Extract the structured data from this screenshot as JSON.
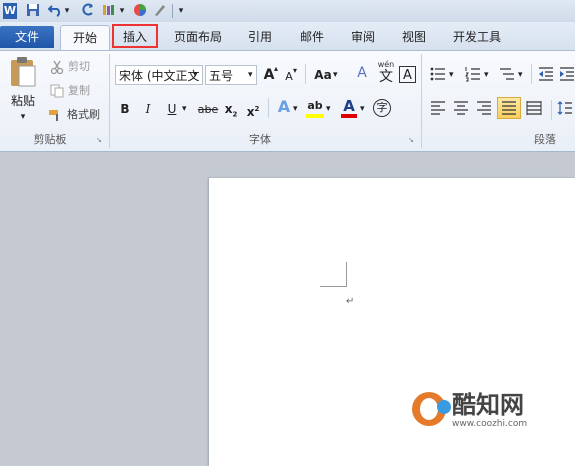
{
  "qat": {
    "word_icon": "W",
    "dropdown_arrow": "▾"
  },
  "tabs": {
    "file": "文件",
    "home": "开始",
    "insert": "插入",
    "page_layout": "页面布局",
    "references": "引用",
    "mailings": "邮件",
    "review": "审阅",
    "view": "视图",
    "developer": "开发工具"
  },
  "clipboard": {
    "paste": "粘贴",
    "cut": "剪切",
    "copy": "复制",
    "format_painter": "格式刷",
    "group_label": "剪贴板"
  },
  "font": {
    "font_name": "宋体 (中文正文",
    "font_size": "五号",
    "grow": "A",
    "shrink": "A",
    "change_case": "Aa",
    "clear_format_glyph": "A",
    "pinyin_top": "wén",
    "pinyin_char": "文",
    "char_border": "A",
    "bold": "B",
    "italic": "I",
    "underline": "U",
    "strikethrough": "abe",
    "subscript": "x",
    "subscript_mark": "2",
    "superscript": "x",
    "superscript_mark": "2",
    "text_effect": "A",
    "highlight": "ab",
    "font_color": "A",
    "enclose_char": "字",
    "group_label": "字体"
  },
  "paragraph": {
    "group_label": "段落"
  },
  "document": {
    "paragraph_mark": "↵"
  },
  "watermark": {
    "brand": "酷知网",
    "url": "www.coozhi.com"
  },
  "colors": {
    "file_tab": "#2a63b6",
    "highlight_yellow": "#ffff00",
    "font_red": "#e00000",
    "insert_box_border": "#e33333"
  }
}
